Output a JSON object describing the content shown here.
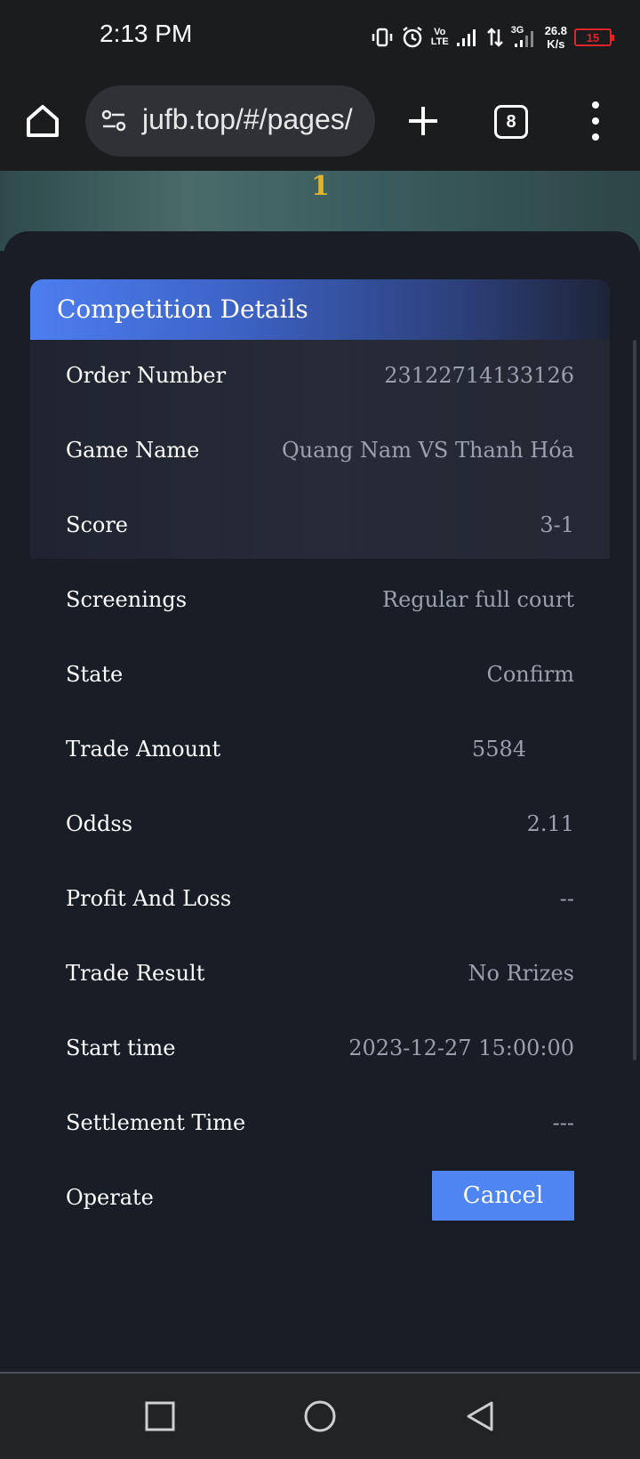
{
  "status_bar": {
    "time": "2:13 PM",
    "volte_top": "Vo",
    "volte_bottom": "LTE",
    "network_type": "3G",
    "net_speed_value": "26.8",
    "net_speed_unit": "K/s",
    "battery_level": "15",
    "icons": [
      "vibrate-icon",
      "alarm-icon",
      "signal-icon",
      "data-arrows-icon",
      "battery-icon"
    ]
  },
  "browser": {
    "url": "jufb.top/#/pages/",
    "tab_count": "8"
  },
  "page": {
    "hero_number": "1",
    "card_title": "Competition Details",
    "details": [
      {
        "label": "Order Number",
        "value": "23122714133126"
      },
      {
        "label": "Game Name",
        "value": "Quang Nam VS Thanh Hóa"
      },
      {
        "label": "Score",
        "value": "3-1"
      },
      {
        "label": "Screenings",
        "value": "Regular full court"
      },
      {
        "label": "State",
        "value": "Confirm"
      },
      {
        "label": "Trade Amount",
        "value": "5584"
      },
      {
        "label": "Oddss",
        "value": "2.11"
      },
      {
        "label": "Profit And Loss",
        "value": "--"
      },
      {
        "label": "Trade Result",
        "value": "No Rrizes"
      },
      {
        "label": "Start time",
        "value": "2023-12-27 15:00:00"
      },
      {
        "label": "Settlement Time",
        "value": "---"
      }
    ],
    "operate_label": "Operate",
    "cancel_label": "Cancel"
  },
  "colors": {
    "accent_blue": "#4f85f2",
    "hero_gold": "#e2b42b",
    "battery_red": "#e0252a",
    "page_bg": "#181d26"
  }
}
